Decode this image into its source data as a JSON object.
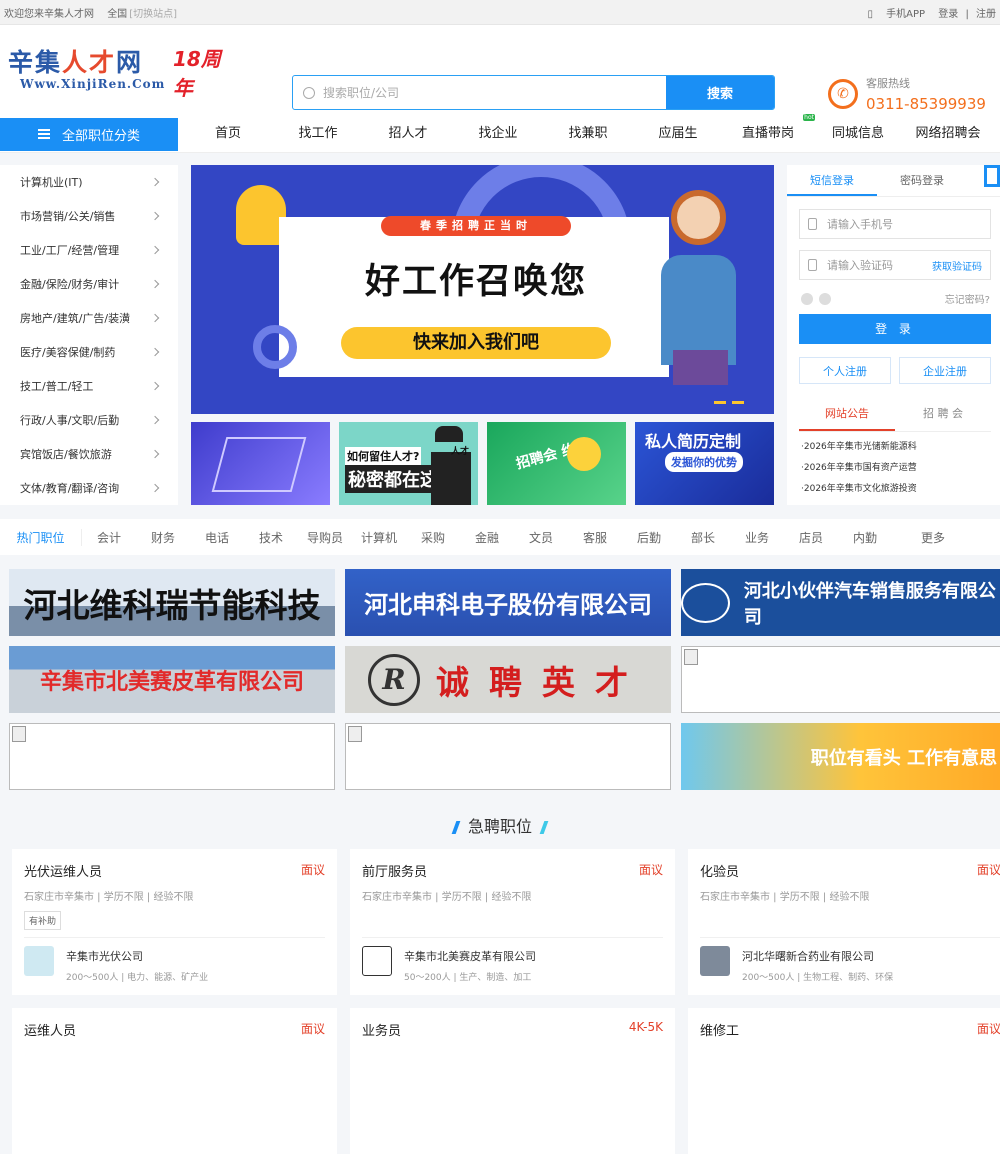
{
  "topbar": {
    "welcome": "欢迎您来辛集人才网",
    "region": "全国",
    "switch": "[切换站点]",
    "app": "手机APP",
    "login": "登录",
    "register": "注册"
  },
  "logo": {
    "name": "辛集人才网",
    "url_text": "Www.XinjiRen.Com",
    "anniv": "18周年"
  },
  "search": {
    "placeholder": "搜索职位/公司",
    "button": "搜索"
  },
  "hotline": {
    "label": "客服热线",
    "number": "0311-85399939"
  },
  "nav": {
    "category_button": "全部职位分类",
    "items": [
      "首页",
      "找工作",
      "招人才",
      "找企业",
      "找兼职",
      "应届生",
      "直播带岗",
      "同城信息",
      "网络招聘会"
    ]
  },
  "categories": [
    "计算机业(IT)",
    "市场营销/公关/销售",
    "工业/工厂/经营/管理",
    "金融/保险/财务/审计",
    "房地产/建筑/广告/装潢",
    "医疗/美容保健/制药",
    "技工/普工/轻工",
    "行政/人事/文职/后勤",
    "宾馆饭店/餐饮旅游",
    "文体/教育/翻译/咨询"
  ],
  "banner": {
    "tag": "春季招聘正当时",
    "headline": "好工作召唤您",
    "sub": "快来加入我们吧"
  },
  "promos": {
    "p2_t1": "如何留住人才?",
    "p2_t2": "秘密都在这里",
    "p2_t3": "人才",
    "p3_t1": "招聘会 约起",
    "p4_t1": "私人简历定制",
    "p4_t2": "发掘你的优势"
  },
  "login": {
    "tab_sms": "短信登录",
    "tab_pwd": "密码登录",
    "phone_placeholder": "请输入手机号",
    "code_placeholder": "请输入验证码",
    "get_code": "获取验证码",
    "forgot": "忘记密码?",
    "login_button": "登 录",
    "personal_reg": "个人注册",
    "company_reg": "企业注册",
    "notice_tab": "网站公告",
    "fair_tab": "招 聘 会",
    "notices": [
      "·2026年辛集市光储新能源科",
      "·2026年辛集市国有资产运营",
      "·2026年辛集市文化旅游投资"
    ]
  },
  "hotjobs": [
    "热门职位",
    "会计",
    "财务",
    "电话",
    "技术",
    "导购员",
    "计算机",
    "采购",
    "金融",
    "文员",
    "客服",
    "后勤",
    "部长",
    "业务",
    "店员",
    "内勤",
    "更多"
  ],
  "ads": {
    "ad1": "河北维科瑞节能科技",
    "ad2": "河北申科电子股份有限公司",
    "ad3": "河北小伙伴汽车销售服务有限公司",
    "ad4": "辛集市北美赛皮革有限公司",
    "ad5": "诚聘英才",
    "ad5_logo": "R",
    "ad9": "职位有看头 工作有意思"
  },
  "urgent": {
    "title": "急聘职位"
  },
  "jobs": [
    {
      "title": "光伏运维人员",
      "salary": "面议",
      "meta": "石家庄市辛集市 | 学历不限 | 经验不限",
      "perk": "有补助",
      "company": "辛集市光伏公司",
      "info": "200～500人 | 电力、能源、矿产业"
    },
    {
      "title": "前厅服务员",
      "salary": "面议",
      "meta": "石家庄市辛集市 | 学历不限 | 经验不限",
      "perk": "",
      "company": "辛集市北美赛皮革有限公司",
      "info": "50～200人 | 生产、制造、加工"
    },
    {
      "title": "化验员",
      "salary": "面议",
      "meta": "石家庄市辛集市 | 学历不限 | 经验不限",
      "perk": "",
      "company": "河北华曙新合药业有限公司",
      "info": "200～500人 | 生物工程、制药、环保"
    },
    {
      "title": "运维人员",
      "salary": "面议"
    },
    {
      "title": "业务员",
      "salary": "4K-5K"
    },
    {
      "title": "维修工",
      "salary": "面议"
    }
  ]
}
